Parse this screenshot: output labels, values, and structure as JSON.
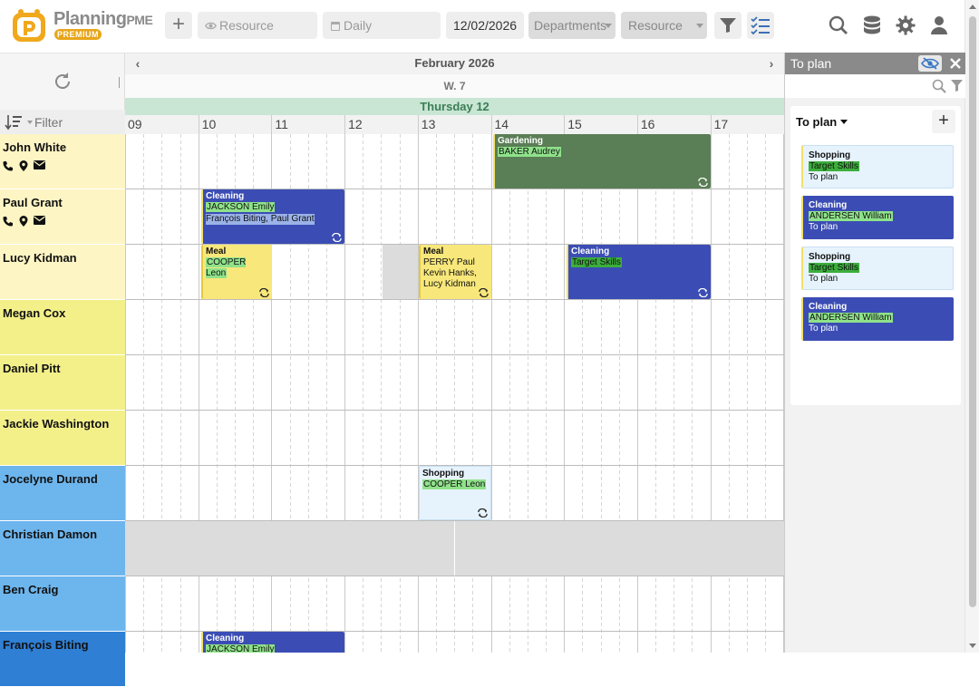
{
  "app": {
    "brand_main": "Planning",
    "brand_suffix": "PME",
    "badge": "PREMIUM"
  },
  "toolbar": {
    "add_label": "+",
    "resource_placeholder": "Resource",
    "view_placeholder": "Daily",
    "date": "12/02/2026",
    "departments_placeholder": "Departments",
    "resource_select": "Resource"
  },
  "timeline": {
    "month": "February 2026",
    "week": "W. 7",
    "day": "Thursday 12",
    "hours": [
      "09",
      "10",
      "11",
      "12",
      "13",
      "14",
      "15",
      "16",
      "17"
    ],
    "prev_label": "‹",
    "next_label": "›"
  },
  "left": {
    "filter_placeholder": "Filter"
  },
  "resources": [
    {
      "name": "John White",
      "color": "#fdf5c4",
      "contact": true
    },
    {
      "name": "Paul Grant",
      "color": "#fdf5c4",
      "contact": true
    },
    {
      "name": "Lucy Kidman",
      "color": "#fdf5c4",
      "contact": false
    },
    {
      "name": "Megan Cox",
      "color": "#f3f08a",
      "contact": false
    },
    {
      "name": "Daniel Pitt",
      "color": "#f3f08a",
      "contact": false
    },
    {
      "name": "Jackie Washington",
      "color": "#f3f08a",
      "contact": false
    },
    {
      "name": "Jocelyne Durand",
      "color": "#6db5ed",
      "contact": false
    },
    {
      "name": "Christian Damon",
      "color": "#6db5ed",
      "contact": false
    },
    {
      "name": "Ben Craig",
      "color": "#6db5ed",
      "contact": false
    },
    {
      "name": "François Biting",
      "color": "#2f7fd4",
      "contact": false
    }
  ],
  "tasks": [
    {
      "title": "Gardening",
      "tag": "BAKER Audrey",
      "lines": [],
      "style": "green"
    },
    {
      "title": "Cleaning",
      "tag": "JACKSON Emily",
      "lines": [
        "François Biting, Paul Grant"
      ],
      "style": "blue"
    },
    {
      "title": "Meal",
      "tag": "COOPER Leon",
      "lines": [],
      "style": "yellow"
    },
    {
      "title": "Meal",
      "tag": "",
      "lines": [
        "PERRY Paul",
        "Kevin Hanks,",
        "Lucy Kidman"
      ],
      "style": "yellow"
    },
    {
      "title": "Cleaning",
      "tag": "Target Skills",
      "lines": [],
      "style": "blue"
    },
    {
      "title": "Shopping",
      "tag": "COOPER Leon",
      "lines": [],
      "style": "light"
    },
    {
      "title": "Cleaning",
      "tag": "JACKSON Emily",
      "lines": [],
      "style": "blue"
    }
  ],
  "panel": {
    "title": "To plan",
    "list_title": "To plan",
    "add_label": "+",
    "items": [
      {
        "title": "Shopping",
        "tag": "Target Skills",
        "sub": "To plan",
        "style": "light"
      },
      {
        "title": "Cleaning",
        "tag": "ANDERSEN William",
        "sub": "To plan",
        "style": "dark"
      },
      {
        "title": "Shopping",
        "tag": "Target Skills",
        "sub": "To plan",
        "style": "light"
      },
      {
        "title": "Cleaning",
        "tag": "ANDERSEN William",
        "sub": "To plan",
        "style": "dark"
      }
    ]
  },
  "colors": {
    "accent": "#e8a51a",
    "day_header": "#c8e6d3",
    "task_blue": "#3b4db4",
    "task_green": "#5a7e56",
    "task_yellow": "#f8e77a",
    "task_light": "#e6f3fd",
    "unavailable": "#dcdcdc"
  }
}
